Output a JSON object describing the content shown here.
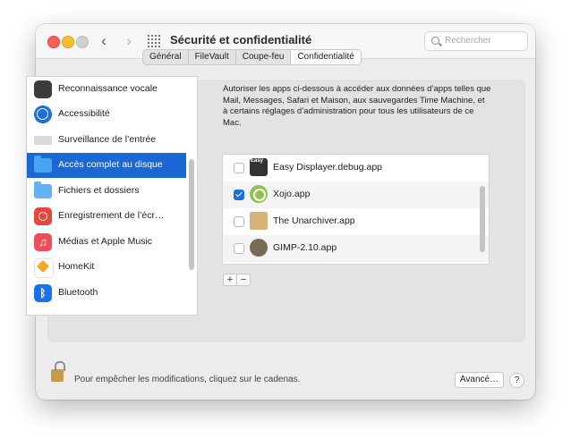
{
  "window": {
    "title": "Sécurité et confidentialité",
    "search_placeholder": "Rechercher"
  },
  "tabs": [
    {
      "label": "Général",
      "active": false
    },
    {
      "label": "FileVault",
      "active": false
    },
    {
      "label": "Coupe-feu",
      "active": false
    },
    {
      "label": "Confidentialité",
      "active": true
    }
  ],
  "sidebar": {
    "items": [
      {
        "label": "Reconnaissance vocale",
        "icon": "voice-waveform-icon"
      },
      {
        "label": "Accessibilité",
        "icon": "accessibility-icon"
      },
      {
        "label": "Surveillance de l’entrée",
        "icon": "keyboard-icon"
      },
      {
        "label": "Accès complet au disque",
        "icon": "folder-icon",
        "selected": true
      },
      {
        "label": "Fichiers et dossiers",
        "icon": "folder-icon"
      },
      {
        "label": "Enregistrement de l’écr…",
        "icon": "screen-record-icon"
      },
      {
        "label": "Médias et Apple Music",
        "icon": "music-note-icon"
      },
      {
        "label": "HomeKit",
        "icon": "home-icon"
      },
      {
        "label": "Bluetooth",
        "icon": "bluetooth-icon"
      }
    ]
  },
  "panel": {
    "description": "Autoriser les apps ci-dessous à accéder aux données d’apps telles que Mail, Messages, Safari et Maison, aux sauvegardes Time Machine, et à certains réglages d’administration pour tous les utilisateurs de ce Mac.",
    "apps": [
      {
        "name": "Easy Displayer.debug.app",
        "checked": false,
        "icon": "easy-displayer-icon"
      },
      {
        "name": "Xojo.app",
        "checked": true,
        "icon": "xojo-icon"
      },
      {
        "name": "The Unarchiver.app",
        "checked": false,
        "icon": "unarchiver-icon"
      },
      {
        "name": "GIMP-2.10.app",
        "checked": false,
        "icon": "gimp-icon"
      }
    ],
    "add_label": "+",
    "remove_label": "−"
  },
  "footer": {
    "lock_text": "Pour empêcher les modifications, cliquez sur le cadenas.",
    "advanced_label": "Avancé…",
    "help_label": "?"
  },
  "colors": {
    "selection": "#1b67d6",
    "checkbox_on": "#1b6fe0",
    "close": "#fe5f57",
    "minimize": "#febc2e"
  }
}
